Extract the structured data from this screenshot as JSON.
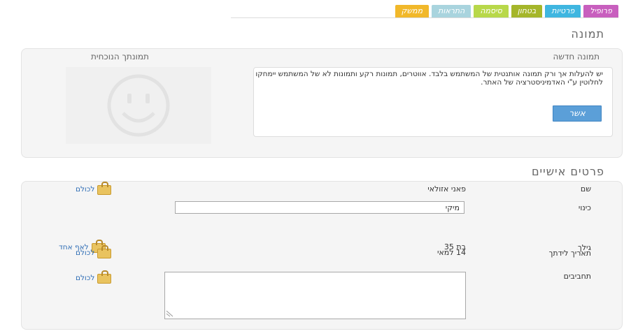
{
  "tabs": [
    {
      "label": "פרופיל",
      "color": "#c85fbe"
    },
    {
      "label": "פרטיות",
      "color": "#3fb6e0"
    },
    {
      "label": "בטחון",
      "color": "#a5b62a"
    },
    {
      "label": "סיסמה",
      "color": "#b8d84a"
    },
    {
      "label": "התראות",
      "color": "#a9d4de"
    },
    {
      "label": "ממשק",
      "color": "#f1b82a"
    }
  ],
  "photo_section": {
    "title": "תמונה",
    "new_photo_label": "תמונה חדשה",
    "current_photo_label": "תמונתך הנוכחית",
    "upload_text": "יש להעלות אך ורק תמונה אותנטית של המשתמש בלבד. אווטרים, תמונות רקע ותמונות לא של המשתמש יימחקו לחלוטין ע\"י האדמיניסטרציה של האתר.",
    "confirm_button": "אשר"
  },
  "personal_section": {
    "title": "פרטים אישיים",
    "rows": {
      "name": {
        "label": "שם",
        "value": "פאני אזולאי",
        "privacy": "לכולם"
      },
      "nickname": {
        "label": "כינוי",
        "value": "מיקי"
      },
      "age": {
        "label": "גילך",
        "value": "בת 35",
        "privacy": "לאף אחד"
      },
      "birthday": {
        "label": "תאריך לידתך",
        "value": "14 למאי",
        "privacy": "לכולם"
      },
      "hobbies": {
        "label": "תחביבים",
        "value": "",
        "privacy": "לכולם"
      }
    }
  },
  "colors": {
    "accent_blue": "#5b9fd8",
    "link_blue": "#2f6db5",
    "panel_bg": "#f5f5f5"
  }
}
